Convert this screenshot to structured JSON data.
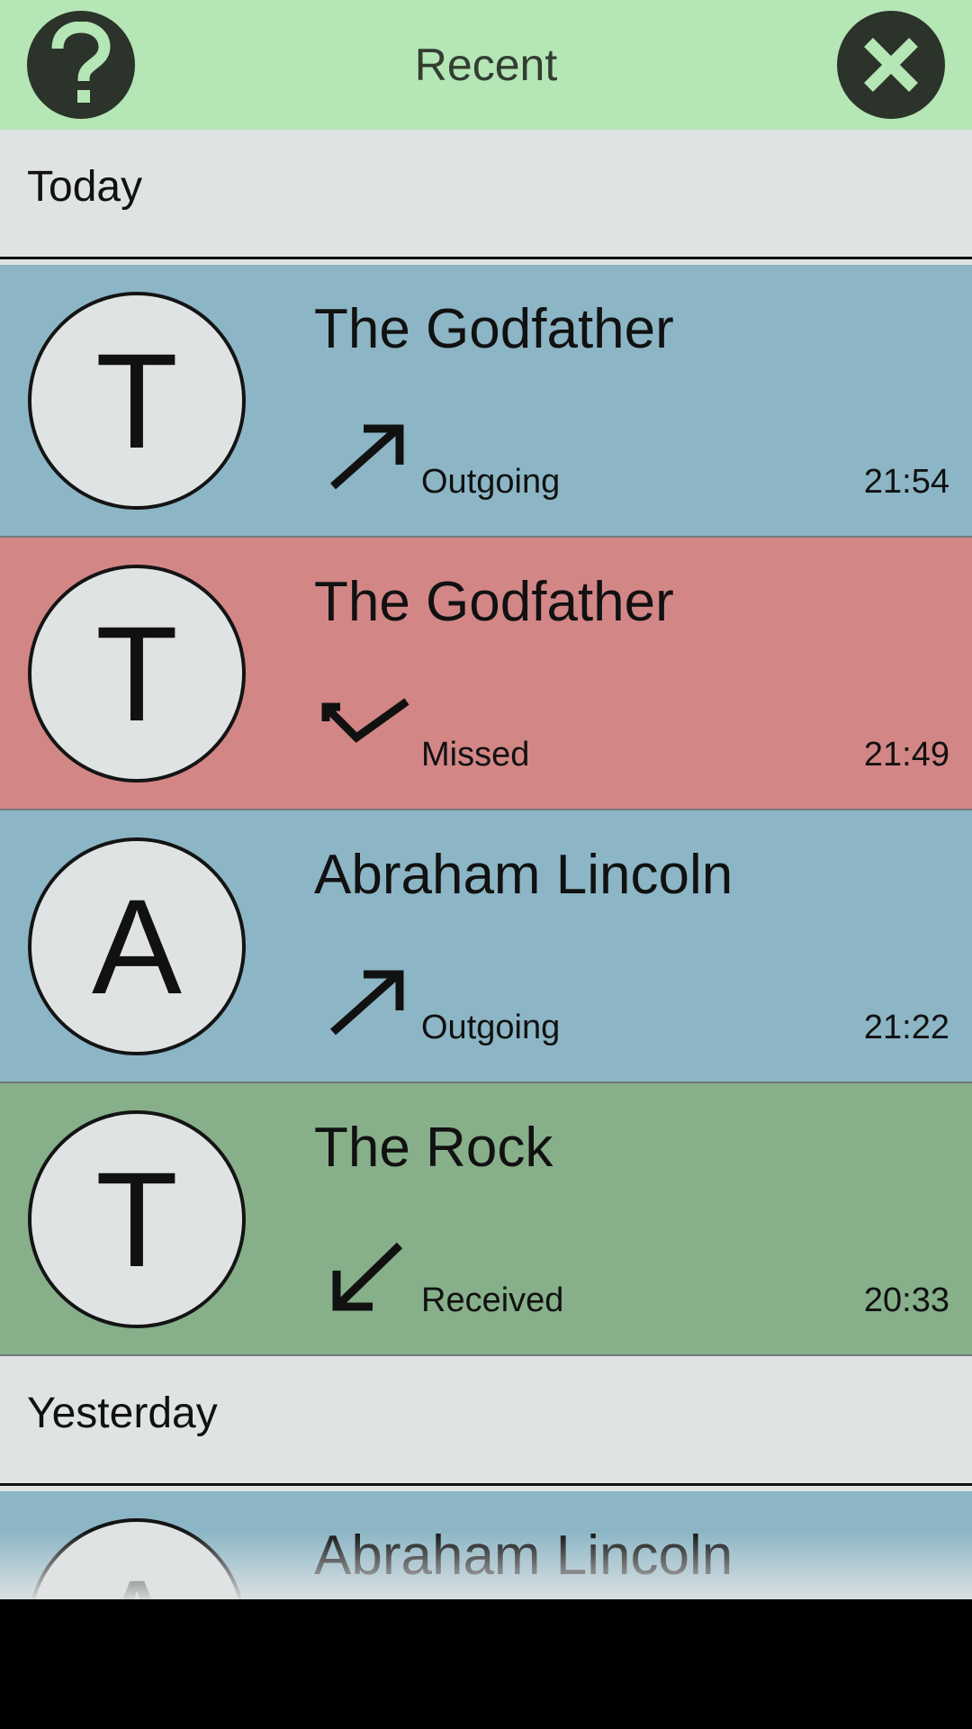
{
  "header": {
    "title": "Recent",
    "help_icon": "question-mark-icon",
    "close_icon": "close-x-icon",
    "background": "#b5e6b5"
  },
  "sections": [
    {
      "label": "Today",
      "calls": [
        {
          "initial": "T",
          "name": "The Godfather",
          "type": "Outgoing",
          "time": "21:54",
          "icon": "outgoing-arrow-icon",
          "color": "#8cb6c5"
        },
        {
          "initial": "T",
          "name": "The Godfather",
          "type": "Missed",
          "time": "21:49",
          "icon": "missed-arrow-icon",
          "color": "#d38686"
        },
        {
          "initial": "A",
          "name": "Abraham Lincoln",
          "type": "Outgoing",
          "time": "21:22",
          "icon": "outgoing-arrow-icon",
          "color": "#8cb6c5"
        },
        {
          "initial": "T",
          "name": "The Rock",
          "type": "Received",
          "time": "20:33",
          "icon": "received-arrow-icon",
          "color": "#86af8a"
        }
      ]
    },
    {
      "label": "Yesterday",
      "calls": [
        {
          "initial": "A",
          "name": "Abraham Lincoln",
          "color": "#8cb6c5"
        }
      ]
    }
  ]
}
